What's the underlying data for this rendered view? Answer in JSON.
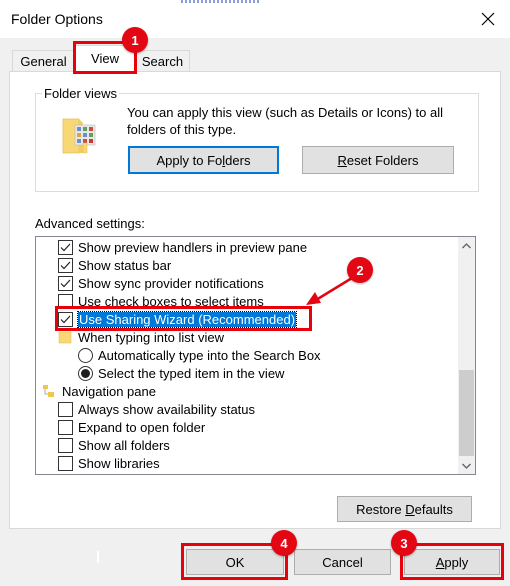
{
  "window": {
    "title": "Folder Options",
    "close_icon": "close-icon"
  },
  "tabs": [
    {
      "label": "General",
      "active": false
    },
    {
      "label": "View",
      "active": true
    },
    {
      "label": "Search",
      "active": false
    }
  ],
  "folder_views": {
    "legend": "Folder views",
    "description": "You can apply this view (such as Details or Icons) to all folders of this type.",
    "icon": "folder-grid-icon",
    "apply_button": {
      "pre": "Apply to Fo",
      "accel": "l",
      "post": "ders"
    },
    "reset_button": {
      "pre": "",
      "accel": "R",
      "post": "eset Folders"
    }
  },
  "advanced": {
    "label": "Advanced settings:",
    "items": [
      {
        "type": "checkbox",
        "label": "Show preview handlers in preview pane",
        "checked": true,
        "indent": 1
      },
      {
        "type": "checkbox",
        "label": "Show status bar",
        "checked": true,
        "indent": 1
      },
      {
        "type": "checkbox",
        "label": "Show sync provider notifications",
        "checked": true,
        "indent": 1
      },
      {
        "type": "checkbox",
        "label": "Use check boxes to select items",
        "checked": false,
        "indent": 1
      },
      {
        "type": "checkbox",
        "label": "Use Sharing Wizard (Recommended)",
        "checked": true,
        "indent": 1,
        "selected": true
      },
      {
        "type": "group",
        "label": "When typing into list view",
        "icon": "folder-icon",
        "indent": 1
      },
      {
        "type": "radio",
        "label": "Automatically type into the Search Box",
        "checked": false,
        "indent": 2
      },
      {
        "type": "radio",
        "label": "Select the typed item in the view",
        "checked": true,
        "indent": 2
      },
      {
        "type": "group",
        "label": "Navigation pane",
        "icon": "navigation-pane-icon",
        "indent": 0
      },
      {
        "type": "checkbox",
        "label": "Always show availability status",
        "checked": false,
        "indent": 1
      },
      {
        "type": "checkbox",
        "label": "Expand to open folder",
        "checked": false,
        "indent": 1
      },
      {
        "type": "checkbox",
        "label": "Show all folders",
        "checked": false,
        "indent": 1
      },
      {
        "type": "checkbox",
        "label": "Show libraries",
        "checked": false,
        "indent": 1
      }
    ],
    "scroll_position": 0.75
  },
  "restore_defaults": {
    "pre": "Restore ",
    "accel": "D",
    "post": "efaults"
  },
  "footer": {
    "ok": "OK",
    "cancel": "Cancel",
    "apply": {
      "pre": "",
      "accel": "A",
      "post": "pply"
    }
  },
  "annotations": [
    {
      "number": "1",
      "target": "View tab"
    },
    {
      "number": "2",
      "target": "Use Sharing Wizard (Recommended)"
    },
    {
      "number": "3",
      "target": "Apply button"
    },
    {
      "number": "4",
      "target": "OK button"
    }
  ],
  "colors": {
    "annotation_red": "#e30613",
    "selection_blue": "#0078d7",
    "dialog_bg": "#f0f0f0"
  }
}
